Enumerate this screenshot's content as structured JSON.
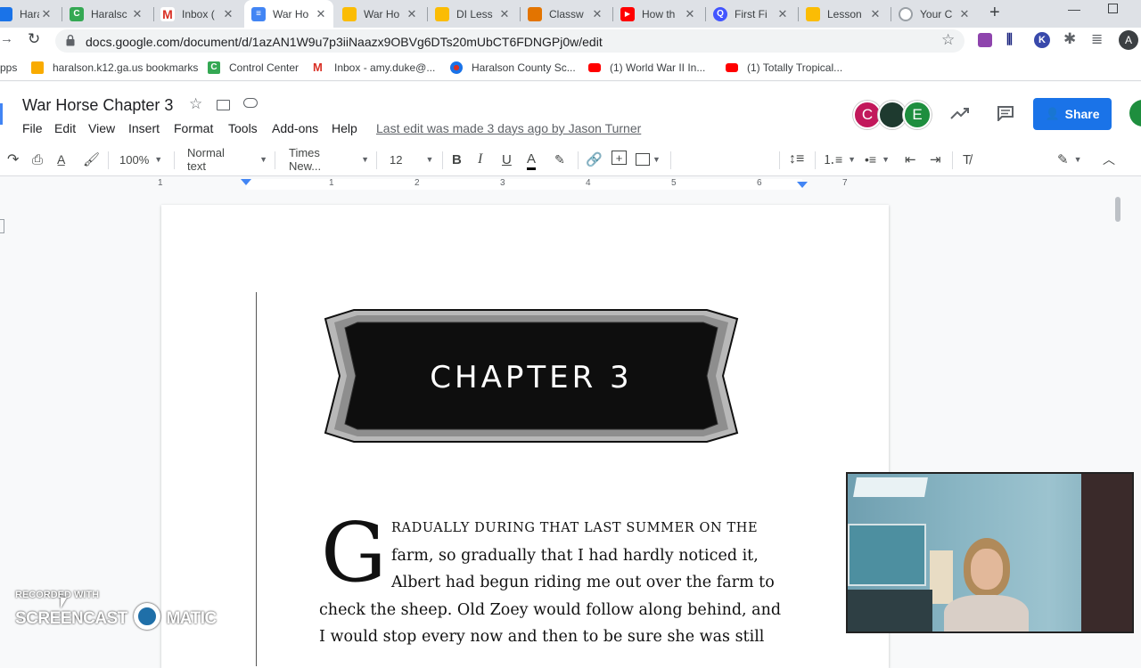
{
  "browser": {
    "tabs": [
      {
        "label": "Haralsc",
        "icon": "haralson-icon",
        "color": "#1a73e8"
      },
      {
        "label": "Haralsc",
        "icon": "control-center-icon",
        "color": "#34a853"
      },
      {
        "label": "Inbox (",
        "icon": "gmail-icon",
        "color": "#d93025"
      },
      {
        "label": "War Ho",
        "icon": "docs-icon",
        "color": "#4285f4",
        "active": true
      },
      {
        "label": "War Ho",
        "icon": "slides-icon",
        "color": "#fbbc04"
      },
      {
        "label": "DI Less",
        "icon": "slides-icon",
        "color": "#fbbc04"
      },
      {
        "label": "Classw",
        "icon": "classroom-icon",
        "color": "#e37400"
      },
      {
        "label": "How th",
        "icon": "youtube-icon",
        "color": "#ff0000"
      },
      {
        "label": "First Fi",
        "icon": "quizlet-icon",
        "color": "#4255ff"
      },
      {
        "label": "Lesson",
        "icon": "slides-icon",
        "color": "#fbbc04"
      },
      {
        "label": "Your C",
        "icon": "generic-icon",
        "color": "#9aa0a6"
      }
    ],
    "url": "docs.google.com/document/d/1azAN1W9u7p3iiNaazx9OBVg6DTs20mUbCT6FDNGPj0w/edit",
    "bookmarks": [
      {
        "label": "pps",
        "icon": "apps-icon"
      },
      {
        "label": "haralson.k12.ga.us bookmarks",
        "icon": "folder-icon"
      },
      {
        "label": "Control Center",
        "icon": "control-center-icon"
      },
      {
        "label": "Inbox - amy.duke@...",
        "icon": "gmail-icon"
      },
      {
        "label": "Haralson County Sc...",
        "icon": "haralson-icon"
      },
      {
        "label": "(1) World War II In...",
        "icon": "youtube-icon"
      },
      {
        "label": "(1) Totally Tropical...",
        "icon": "youtube-icon"
      }
    ]
  },
  "docs": {
    "title": "War Horse Chapter 3",
    "menu": [
      "File",
      "Edit",
      "View",
      "Insert",
      "Format",
      "Tools",
      "Add-ons",
      "Help"
    ],
    "last_edit": "Last edit was made 3 days ago by Jason Turner",
    "avatars": [
      {
        "letter": "C",
        "color": "#c2185b"
      },
      {
        "letter": "",
        "color": "#1e3a2f"
      },
      {
        "letter": "E",
        "color": "#1e8e3e"
      }
    ],
    "share_label": "Share",
    "toolbar": {
      "zoom": "100%",
      "style": "Normal text",
      "font": "Times New...",
      "size": "12"
    },
    "ruler_numbers": [
      "1",
      "1",
      "2",
      "3",
      "4",
      "5",
      "6",
      "7"
    ]
  },
  "page": {
    "chapter_heading": "CHAPTER 3",
    "drop_cap": "G",
    "lines": [
      "RADUALLY DURING THAT LAST SUMMER ON THE",
      "farm, so gradually that I had hardly noticed it,",
      "Albert had begun riding me out over the farm to",
      "check the sheep. Old Zoey would follow along behind, and",
      "I would stop every now and then to be sure she was still"
    ]
  },
  "watermark": {
    "top": "RECORDED WITH",
    "main_left": "SCREENCAST",
    "main_right": "MATIC"
  }
}
